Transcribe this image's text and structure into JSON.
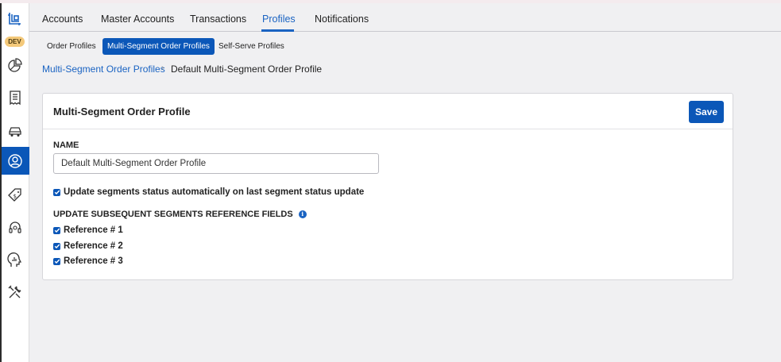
{
  "environment_badge": "DEV",
  "sidebar": {
    "icons": [
      "logo-icon",
      "pie-chart-icon",
      "receipt-icon",
      "car-icon",
      "user-circle-icon",
      "price-tag-icon",
      "headset-icon",
      "analytics-head-icon",
      "tools-icon"
    ],
    "active": "user-circle-icon"
  },
  "nav": {
    "tabs": [
      {
        "label": "Accounts"
      },
      {
        "label": "Master Accounts"
      },
      {
        "label": "Transactions"
      },
      {
        "label": "Profiles"
      },
      {
        "label": "Notifications"
      }
    ],
    "active_tab": "Profiles"
  },
  "subnav": {
    "tabs": [
      {
        "label": "Order Profiles"
      },
      {
        "label": "Multi-Segment Order Profiles"
      },
      {
        "label": "Self-Serve Profiles"
      }
    ],
    "active_tab": "Multi-Segment Order Profiles"
  },
  "breadcrumb": {
    "parent": "Multi-Segment Order Profiles",
    "separator": "›",
    "current": "Default Multi-Segment Order Profile"
  },
  "card": {
    "title": "Multi-Segment Order Profile",
    "save_label": "Save",
    "name_label": "NAME",
    "name_value": "Default Multi-Segment Order Profile",
    "auto_update": {
      "label": "Update segments status automatically on last segment status update",
      "checked": true
    },
    "reference_section_label": "UPDATE SUBSEQUENT SEGMENTS REFERENCE FIELDS",
    "info_glyph": "i",
    "references": [
      {
        "label": "Reference # 1",
        "checked": true
      },
      {
        "label": "Reference # 2",
        "checked": true
      },
      {
        "label": "Reference # 3",
        "checked": true
      }
    ]
  },
  "colors": {
    "accent": "#0b57b8",
    "link": "#1a63c2",
    "background": "#f0f0f2"
  }
}
